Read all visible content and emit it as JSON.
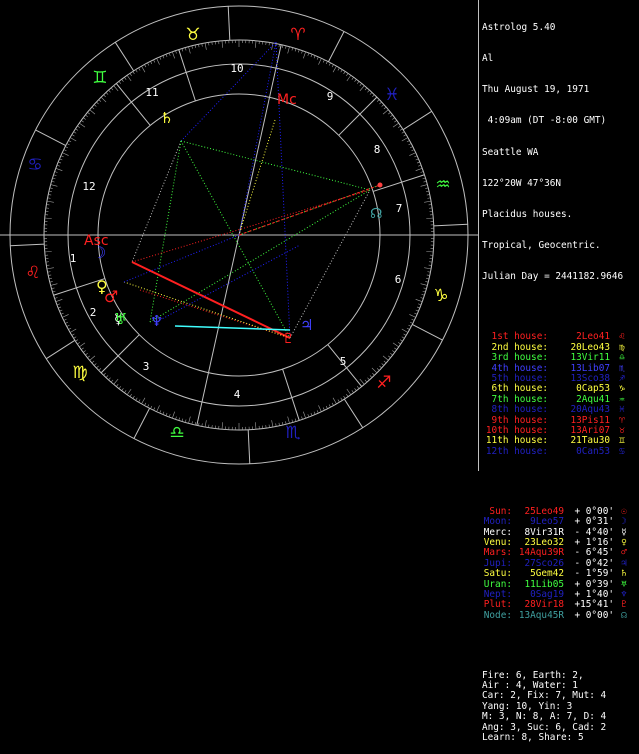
{
  "header": {
    "app": "Astrolog 5.40",
    "name": "Al",
    "date": "Thu August 19, 1971",
    "time": " 4:09am (DT -8:00 GMT)",
    "place": "Seattle WA",
    "coords": "122°20W 47°36N",
    "house_system": "Placidus houses.",
    "zodiac": "Tropical, Geocentric.",
    "julian": "Julian Day = 2441182.9646"
  },
  "houses": [
    {
      "label": "1st house:",
      "value": "2Leo41",
      "glyph": "♌",
      "color": "#ff2020"
    },
    {
      "label": "2nd house:",
      "value": "20Leo43",
      "glyph": "♍",
      "color": "#ffff40"
    },
    {
      "label": "3rd house:",
      "value": "13Vir11",
      "glyph": "♎",
      "color": "#40ff40"
    },
    {
      "label": "4th house:",
      "value": "13Lib07",
      "glyph": "♏",
      "color": "#4040ff"
    },
    {
      "label": "5th house:",
      "value": "13Sco38",
      "glyph": "♐",
      "color": "#2020c0"
    },
    {
      "label": "6th house:",
      "value": "0Cap53",
      "glyph": "♑",
      "color": "#ffff40"
    },
    {
      "label": "7th house:",
      "value": "2Aqu41",
      "glyph": "♒",
      "color": "#40ff40"
    },
    {
      "label": "8th house:",
      "value": "20Aqu43",
      "glyph": "♓",
      "color": "#2020c0"
    },
    {
      "label": "9th house:",
      "value": "13Pis11",
      "glyph": "♈",
      "color": "#ff2020"
    },
    {
      "label": "10th house:",
      "value": "13Ari07",
      "glyph": "♉",
      "color": "#ff2020"
    },
    {
      "label": "11th house:",
      "value": "21Tau30",
      "glyph": "♊",
      "color": "#ffff40"
    },
    {
      "label": "12th house:",
      "value": "0Can53",
      "glyph": "♋",
      "color": "#2020c0"
    }
  ],
  "planets": [
    {
      "label": "Sun:",
      "value": "25Leo49",
      "aspect": "+ 0°00'",
      "glyph": "☉",
      "color": "#ff2020"
    },
    {
      "label": "Moon:",
      "value": "9Leo57",
      "aspect": "+ 0°31'",
      "glyph": "☽",
      "color": "#2020c0"
    },
    {
      "label": "Merc:",
      "value": "8Vir31R",
      "aspect": "- 4°40'",
      "glyph": "☿",
      "color": "#ffffff"
    },
    {
      "label": "Venu:",
      "value": "23Leo32",
      "aspect": "+ 1°16'",
      "glyph": "♀",
      "color": "#ffff40"
    },
    {
      "label": "Mars:",
      "value": "14Aqu39R",
      "aspect": "- 6°45'",
      "glyph": "♂",
      "color": "#ff2020"
    },
    {
      "label": "Jupi:",
      "value": "27Sco26",
      "aspect": "- 0°42'",
      "glyph": "♃",
      "color": "#2020c0"
    },
    {
      "label": "Satu:",
      "value": "5Gem42",
      "aspect": "- 1°59'",
      "glyph": "♄",
      "color": "#ffff40"
    },
    {
      "label": "Uran:",
      "value": "11Lib05",
      "aspect": "+ 0°39'",
      "glyph": "♅",
      "color": "#40ff40"
    },
    {
      "label": "Nept:",
      "value": "0Sag19",
      "aspect": "+ 1°40'",
      "glyph": "♆",
      "color": "#2020c0"
    },
    {
      "label": "Plut:",
      "value": "28Vir18",
      "aspect": "+15°41'",
      "glyph": "♇",
      "color": "#ff2020"
    },
    {
      "label": "Node:",
      "value": "13Aqu45R",
      "aspect": "+ 0°00'",
      "glyph": "☊",
      "color": "#40a0a0"
    }
  ],
  "summary": [
    "Fire: 6, Earth: 2,",
    "Air : 4, Water: 1",
    "Car: 2, Fix: 7, Mut: 4",
    "Yang: 10, Yin: 3",
    "M: 3, N: 8, A: 7, D: 4",
    "Ang: 3, Suc: 6, Cad: 2",
    "Learn: 8, Share: 5"
  ],
  "wheel": {
    "house_numbers": [
      "1",
      "2",
      "3",
      "4",
      "5",
      "6",
      "7",
      "8",
      "9",
      "10",
      "11",
      "12"
    ],
    "signs": [
      {
        "glyph": "♉",
        "color": "#ffff40"
      },
      {
        "glyph": "♈",
        "color": "#ff2020"
      },
      {
        "glyph": "♓",
        "color": "#2020c0"
      },
      {
        "glyph": "♒",
        "color": "#40ff40"
      },
      {
        "glyph": "♑",
        "color": "#ffff40"
      },
      {
        "glyph": "♐",
        "color": "#ff2020"
      },
      {
        "glyph": "♏",
        "color": "#2020c0"
      },
      {
        "glyph": "♎",
        "color": "#40ff40"
      },
      {
        "glyph": "♍",
        "color": "#ffff40"
      },
      {
        "glyph": "♌",
        "color": "#ff2020"
      },
      {
        "glyph": "♋",
        "color": "#2020c0"
      },
      {
        "glyph": "♊",
        "color": "#40ff40"
      }
    ],
    "planet_glyphs": {
      "saturn": "♄",
      "uranus": "♅",
      "neptune": "♆",
      "jupiter": "♃",
      "pluto": "♇",
      "venus": "♀",
      "mars": "♂",
      "mercury": "☿",
      "moon": "☽",
      "node": "☊",
      "asc": "Asc",
      "mc": "Mc"
    }
  }
}
